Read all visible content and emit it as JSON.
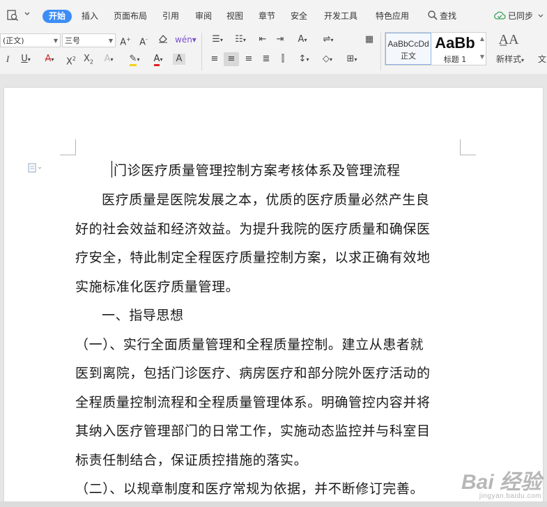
{
  "menubar": {
    "tabs": [
      {
        "label": "开始",
        "active": true
      },
      {
        "label": "插入"
      },
      {
        "label": "页面布局"
      },
      {
        "label": "引用"
      },
      {
        "label": "审阅"
      },
      {
        "label": "视图"
      },
      {
        "label": "章节"
      },
      {
        "label": "安全"
      },
      {
        "label": "开发工具"
      },
      {
        "label": "特色应用"
      }
    ],
    "search_label": "查找",
    "sync_label": "已同步",
    "accent": "#3b8ef6"
  },
  "ribbon": {
    "font_name": "(正文)",
    "font_size": "三号",
    "styles": [
      {
        "sample": "AaBbCcDd",
        "name": "正文"
      },
      {
        "sample": "AaBb",
        "name": "标题 1"
      }
    ],
    "new_style_label": "新样式",
    "cut_off_label": "文"
  },
  "document": {
    "title": "门诊医疗质量管理控制方案考核体系及管理流程",
    "lines": [
      "医疗质量是医院发展之本，优质的医疗质量必然产生良",
      "好的社会效益和经济效益。为提升我院的医疗质量和确保医",
      "疗安全，特此制定全程医疗质量控制方案，以求正确有效地",
      "实施标准化医疗质量管理。",
      "一、指导思想",
      "（一）、实行全面质量管理和全程质量控制。建立从患者就",
      "医到离院，包括门诊医疗、病房医疗和部分院外医疗活动的",
      "全程质量控制流程和全程质量管理体系。明确管控内容并将",
      "其纳入医疗管理部门的日常工作，实施动态监控并与科室目",
      "标责任制结合，保证质控措施的落实。",
      "（二）、以规章制度和医疗常规为依据，并不断修订完善。"
    ]
  },
  "watermark": {
    "text": "Bai 经验",
    "sub": "jingyan.baidu.com"
  }
}
